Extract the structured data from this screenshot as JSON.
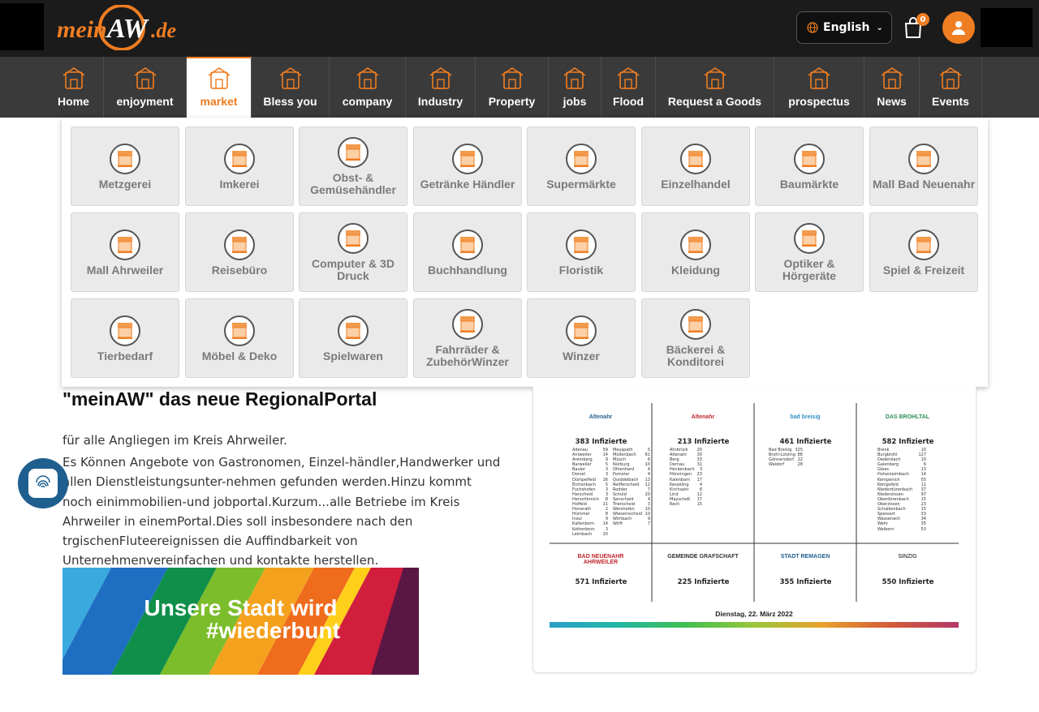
{
  "header": {
    "logo_text": "meinAW.de",
    "language": "English",
    "cart_count": "0"
  },
  "nav": [
    {
      "label": "Home",
      "icon": "home-icon"
    },
    {
      "label": "enjoyment",
      "icon": "food-icon"
    },
    {
      "label": "market",
      "icon": "market-icon",
      "active": true
    },
    {
      "label": "Bless you",
      "icon": "heart-hands-icon"
    },
    {
      "label": "company",
      "icon": "buildings-icon"
    },
    {
      "label": "Industry",
      "icon": "factory-icon"
    },
    {
      "label": "Property",
      "icon": "house-icon"
    },
    {
      "label": "jobs",
      "icon": "worker-icon"
    },
    {
      "label": "Flood",
      "icon": "flood-icon"
    },
    {
      "label": "Request a Goods",
      "icon": "goods-icon"
    },
    {
      "label": "prospectus",
      "icon": "brochure-icon"
    },
    {
      "label": "News",
      "icon": "newspaper-icon"
    },
    {
      "label": "Events",
      "icon": "calendar-icon"
    }
  ],
  "market_categories": [
    "Metzgerei",
    "Imkerei",
    "Obst- & Gemüsehändler",
    "Getränke Händler",
    "Supermärkte",
    "Einzelhandel",
    "Baumärkte",
    "Mall Bad Neuenahr",
    "Mall Ahrweiler",
    "Reisebüro",
    "Computer & 3D Druck",
    "Buchhandlung",
    "Floristik",
    "Kleidung",
    "Optiker & Hörgeräte",
    "Spiel & Freizeit",
    "Tierbedarf",
    "Möbel & Deko",
    "Spielwaren",
    "Fahrräder & ZubehörWinzer",
    "Winzer",
    "Bäckerei & Konditorei"
  ],
  "main": {
    "heading": "\"meinAW\" das neue RegionalPortal",
    "intro_line": "für alle Angliegen im Kreis Ahrweiler.",
    "intro_text": "Es Können Angebote von Gastronomen, Einzel-händler,Handwerker und allen Dienstleistungsunter-nehmen gefunden werden.Hinzu kommt noch einimmobilien-und jobportal.Kurzum...alle Betriebe im Kreis Ahrweiler in einemPortal.Dies soll insbesondere nach den trgischenFluteereignissen die Auffindbarkeit von Unternehmenvereinfachen und kontakte herstellen.",
    "banner_line1": "Unsere Stadt wird",
    "banner_line2": "#wiederbunt"
  },
  "map": {
    "regions": [
      {
        "name": "Altenahr",
        "count": "383 Infizierte"
      },
      {
        "name": "Altenahr",
        "count": "213 Infizierte"
      },
      {
        "name": "bad breisig",
        "count": "461 Infizierte"
      },
      {
        "name": "DAS BROHLTAL",
        "count": "582 Infizierte"
      },
      {
        "name": "BAD NEUENAHR AHRWEILER",
        "count": "571 Infizierte"
      },
      {
        "name": "GEMEINDE GRAFSCHAFT",
        "count": "225 Infizierte"
      },
      {
        "name": "STADT REMAGEN",
        "count": "355 Infizierte"
      },
      {
        "name": "SINZIG",
        "count": "550 Infizierte"
      }
    ],
    "list1a": [
      [
        "Adenau",
        "59"
      ],
      [
        "Antweiler",
        "14"
      ],
      [
        "Aremberg",
        "9"
      ],
      [
        "Barweiler",
        "5"
      ],
      [
        "Bauler",
        "3"
      ],
      [
        "Dorsel",
        "3"
      ],
      [
        "Dümpelfeld",
        "16"
      ],
      [
        "Eichenbach",
        "5"
      ],
      [
        "Fuchshofen",
        "3"
      ],
      [
        "Harscheid",
        "3"
      ],
      [
        "Herschbroich",
        "8"
      ],
      [
        "Hoffeld",
        "11"
      ],
      [
        "Honerath",
        "2"
      ],
      [
        "Hümmel",
        "8"
      ],
      [
        "Insul",
        "9"
      ],
      [
        "Kaltenborn",
        "14"
      ],
      [
        "Kottenborn",
        "3"
      ],
      [
        "Leimbach",
        "20"
      ]
    ],
    "list1b": [
      [
        "Meuspath",
        "5"
      ],
      [
        "Müllenbach",
        "61"
      ],
      [
        "Müsch",
        "6"
      ],
      [
        "Nürburg",
        "10"
      ],
      [
        "Ohlenhard",
        "4"
      ],
      [
        "Pomster",
        "4"
      ],
      [
        "Quiddelbach",
        "13"
      ],
      [
        "Reifferscheid",
        "12"
      ],
      [
        "Rodder",
        "7"
      ],
      [
        "Schuld",
        "20"
      ],
      [
        "Senscheid",
        "4"
      ],
      [
        "Trierscheid",
        "3"
      ],
      [
        "Wershofen",
        "10"
      ],
      [
        "Wiesemscheid",
        "10"
      ],
      [
        "Wimbach",
        "9"
      ],
      [
        "Wirft",
        "7"
      ]
    ],
    "list2": [
      [
        "Ahrbrück",
        "20"
      ],
      [
        "Altenahr",
        "30"
      ],
      [
        "Berg",
        "33"
      ],
      [
        "Dernau",
        "31"
      ],
      [
        "Heckenbach",
        "3"
      ],
      [
        "Hönningen",
        "23"
      ],
      [
        "Kalenborn",
        "17"
      ],
      [
        "Kesseling",
        "4"
      ],
      [
        "Kirchsahr",
        "8"
      ],
      [
        "Lind",
        "12"
      ],
      [
        "Mayschoß",
        "17"
      ],
      [
        "Rech",
        "15"
      ]
    ],
    "list3": [
      [
        "Bad Breisig",
        "325"
      ],
      [
        "Brohl-Lützing",
        "86"
      ],
      [
        "Gönnersdorf",
        "22"
      ],
      [
        "Waldorf",
        "28"
      ]
    ],
    "list4": [
      [
        "Brenk",
        "10"
      ],
      [
        "Burgbrohl",
        "127"
      ],
      [
        "Dedenbach",
        "10"
      ],
      [
        "Galenberg",
        "6"
      ],
      [
        "Glees",
        "13"
      ],
      [
        "Hohenleimbach",
        "14"
      ],
      [
        "Kempenich",
        "55"
      ],
      [
        "Königsfeld",
        "11"
      ],
      [
        "Niederdürenbach",
        "37"
      ],
      [
        "Niederzissen",
        "97"
      ],
      [
        "Oberdürenbach",
        "15"
      ],
      [
        "Oberzissen",
        "23"
      ],
      [
        "Schalkenbach",
        "15"
      ],
      [
        "Spessart",
        "33"
      ],
      [
        "Wassenach",
        "34"
      ],
      [
        "Wehr",
        "35"
      ],
      [
        "Weibern",
        "53"
      ]
    ],
    "date": "Dienstag, 22. März 2022"
  },
  "colors": {
    "accent": "#ef7d22",
    "topbar": "#1b1b1b",
    "navbar": "#3a3a3a",
    "tile_bg": "#eaeaea",
    "badge": "#1f5f8f"
  }
}
